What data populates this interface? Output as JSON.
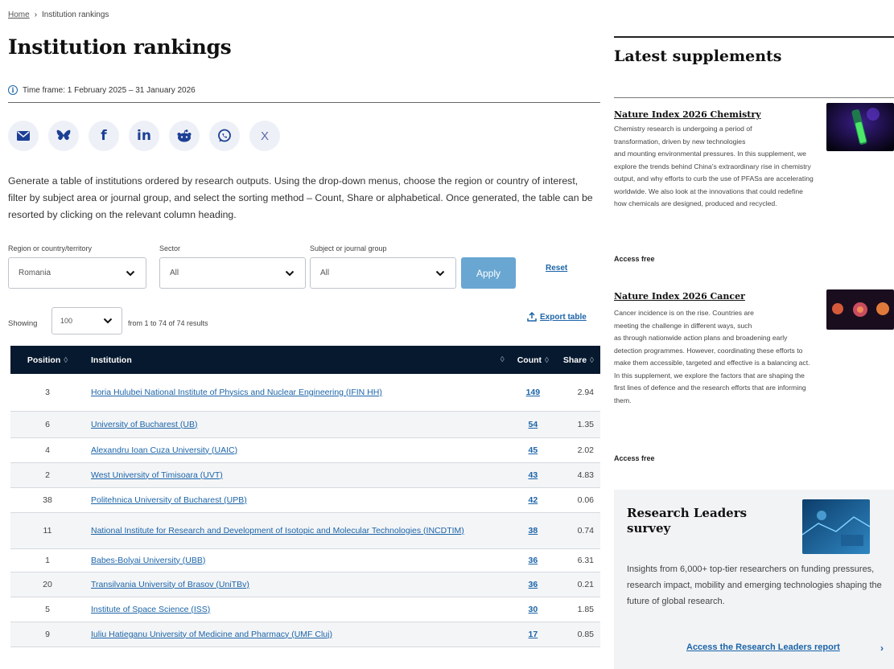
{
  "breadcrumb": {
    "home": "Home",
    "separator": "›",
    "current": "Institution rankings"
  },
  "page": {
    "title": "Institution rankings",
    "timeframe": "Time frame: 1 February 2025 – 31 January 2026",
    "intro": "Generate a table of institutions ordered by research outputs. Using the drop-down menus, choose the region or country of interest, filter by subject area or journal group, and select the sorting method – Count, Share or alphabetical. Once generated, the table can be resorted by clicking on the relevant column heading."
  },
  "share": {
    "x_label": "X"
  },
  "filters": {
    "region_label": "Region or country/territory",
    "region_value": "Romania",
    "sector_label": "Sector",
    "sector_value": "All",
    "subject_label": "Subject or journal group",
    "subject_value": "All",
    "apply": "Apply",
    "reset": "Reset"
  },
  "results": {
    "showing_label": "Showing",
    "page_size": "100",
    "summary": "from 1 to 74 of 74 results",
    "export": "Export table"
  },
  "table": {
    "headers": {
      "position": "Position",
      "institution": "Institution",
      "count": "Count",
      "share": "Share"
    },
    "sort_glyph": "◊",
    "rows": [
      {
        "position": "3",
        "institution": "Horia Hulubei National Institute of Physics and Nuclear Engineering (IFIN HH)",
        "count": "149",
        "share": "2.94"
      },
      {
        "position": "6",
        "institution": "University of Bucharest (UB)",
        "count": "54",
        "share": "1.35"
      },
      {
        "position": "4",
        "institution": "Alexandru Ioan Cuza University (UAIC)",
        "count": "45",
        "share": "2.02"
      },
      {
        "position": "2",
        "institution": "West University of Timisoara (UVT)",
        "count": "43",
        "share": "4.83"
      },
      {
        "position": "38",
        "institution": "Politehnica University of Bucharest (UPB)",
        "count": "42",
        "share": "0.06"
      },
      {
        "position": "11",
        "institution": "National Institute for Research and Development of Isotopic and Molecular Technologies (INCDTIM)",
        "count": "38",
        "share": "0.74"
      },
      {
        "position": "1",
        "institution": "Babes-Bolyai University (UBB)",
        "count": "36",
        "share": "6.31"
      },
      {
        "position": "20",
        "institution": "Transilvania University of Brasov (UniTBv)",
        "count": "36",
        "share": "0.21"
      },
      {
        "position": "5",
        "institution": "Institute of Space Science (ISS)",
        "count": "30",
        "share": "1.85"
      },
      {
        "position": "9",
        "institution": "Iuliu Hatieganu University of Medicine and Pharmacy (UMF Cluj)",
        "count": "17",
        "share": "0.85"
      }
    ]
  },
  "sidebar": {
    "title": "Latest supplements",
    "supplements": [
      {
        "title": "Nature Index 2026 Chemistry",
        "body_lines": [
          "Chemistry research is undergoing a period of",
          "transformation, driven by new technologies",
          "and mounting environmental pressures. In this supplement, we",
          "explore the trends behind China's extraordinary rise in chemistry",
          "output, and why efforts to curb the use of PFASs are accelerating",
          "worldwide. We also look at the innovations that could redefine",
          "how chemicals are designed, produced and recycled."
        ],
        "access": "Access free"
      },
      {
        "title": "Nature Index 2026 Cancer",
        "body_lines": [
          "Cancer incidence is on the rise. Countries are",
          "meeting the challenge in different ways, such",
          "as through nationwide action plans and broadening early",
          "detection programmes. However, coordinating these efforts to",
          "make them accessible, targeted and effective is a balancing act.",
          "In this supplement, we explore the factors that are shaping the",
          "first lines of defence and the research efforts that are informing",
          "them."
        ],
        "access": "Access free"
      }
    ],
    "leaders": {
      "title": "Research Leaders survey",
      "body": "Insights from 6,000+ top-tier researchers on funding pressures, research impact, mobility and emerging technologies shaping the future of global research.",
      "link": "Access the Research Leaders report",
      "chevron": "›"
    }
  },
  "colors": {
    "table_header": "#07192f",
    "link": "#1b64a8",
    "apply": "#69a6d2"
  }
}
